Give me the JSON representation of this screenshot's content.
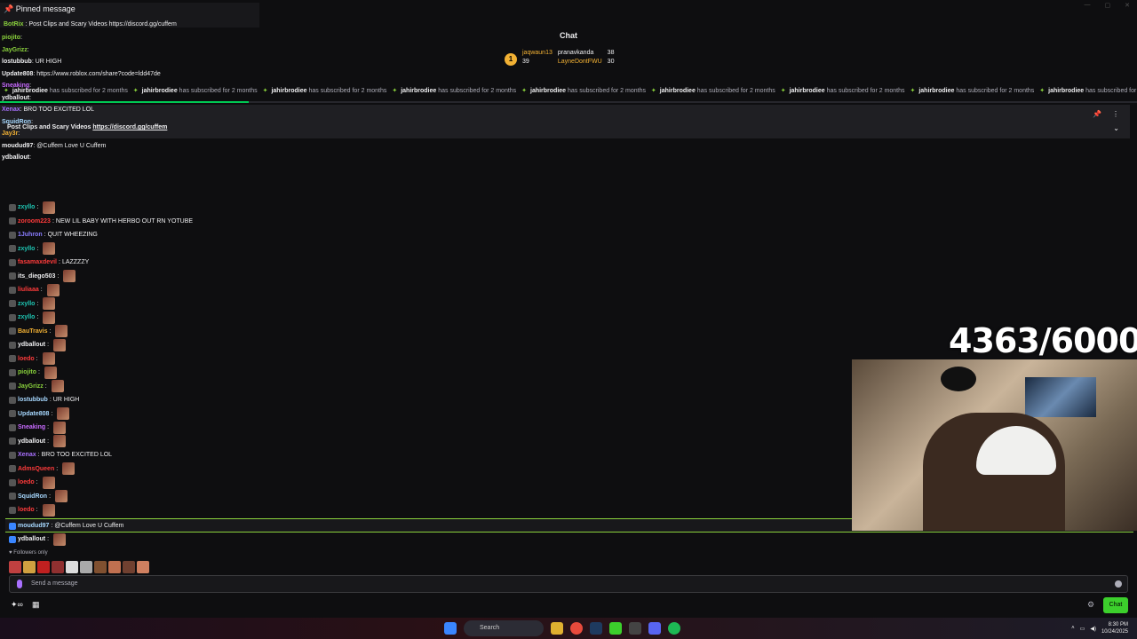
{
  "pinned_top": {
    "title": "Pinned message",
    "user": "BotRix",
    "text": "Post Clips and Scary Videos https://discord.gg/cuffem"
  },
  "header": {
    "title": "Chat"
  },
  "leaderboard": {
    "first": {
      "name": "jaqwaun13",
      "count": "39"
    },
    "second": {
      "name": "pranavkanda",
      "count": "38"
    },
    "third": {
      "name": "LayneDontFWU",
      "count": "30"
    }
  },
  "ticker": {
    "user": "jahirbrodiee",
    "text": "has subscribed for 2 months"
  },
  "progress": {
    "fraction": 0.47
  },
  "pinned_card": {
    "text": "Post Clips and Scary Videos ",
    "link": "https://discord.gg/cuffem"
  },
  "left_chat": [
    {
      "user": "piojito",
      "text": ""
    },
    {
      "user": "JayGrizz",
      "text": ""
    },
    {
      "user": "lostubbub",
      "text": "UR HIGH"
    },
    {
      "user": "Update808",
      "text": "https://www.roblox.com/share?code=ldd47de"
    },
    {
      "user": "Sneaking",
      "text": ""
    },
    {
      "user": "ydballout",
      "text": ""
    },
    {
      "user": "Xenax",
      "text": "BRO TOO EXCITED LOL"
    },
    {
      "user": "SquidRon",
      "text": ""
    },
    {
      "user": "Jay3r",
      "text": ""
    },
    {
      "user": "moudud97",
      "text": "@Cuffem Love U Cuffem"
    },
    {
      "user": "ydballout",
      "text": ""
    }
  ],
  "messages": [
    {
      "user": "zxyllo",
      "text": "",
      "color": "#1ec7b4"
    },
    {
      "user": "zoroom223",
      "text": "NEW LIL BABY WITH HERBO OUT RN YOTUBE",
      "color": "#ff3b3b"
    },
    {
      "user": "1Juhron",
      "text": "QUIT WHEEZING",
      "color": "#8a7dff"
    },
    {
      "user": "zxyllo",
      "text": "",
      "color": "#1ec7b4"
    },
    {
      "user": "fasamaxdevil",
      "text": "LAZZZZY",
      "color": "#ff3b3b"
    },
    {
      "user": "its_diego503",
      "text": "",
      "color": "#efeff1"
    },
    {
      "user": "liuliaaa",
      "text": "",
      "color": "#ff3b3b"
    },
    {
      "user": "zxyllo",
      "text": "",
      "color": "#1ec7b4"
    },
    {
      "user": "zxyllo",
      "text": "",
      "color": "#1ec7b4"
    },
    {
      "user": "BauTravis",
      "text": "",
      "color": "#f2b134"
    },
    {
      "user": "ydballout",
      "text": "",
      "color": "#efeff1"
    },
    {
      "user": "loedo",
      "text": "",
      "color": "#ff3b3b"
    },
    {
      "user": "piojito",
      "text": "",
      "color": "#8ad23c"
    },
    {
      "user": "JayGrizz",
      "text": "",
      "color": "#8ad23c"
    },
    {
      "user": "lostubbub",
      "text": "UR HIGH",
      "color": "#a7d8ff"
    },
    {
      "user": "Update808",
      "text": "",
      "color": "#a7d8ff"
    },
    {
      "user": "Sneaking",
      "text": "",
      "color": "#c86bff"
    },
    {
      "user": "ydballout",
      "text": "",
      "color": "#efeff1"
    },
    {
      "user": "Xenax",
      "text": "BRO TOO EXCITED LOL",
      "color": "#a970ff"
    },
    {
      "user": "AdmsQueen",
      "text": "",
      "color": "#ff3b3b"
    },
    {
      "user": "loedo",
      "text": "",
      "color": "#ff3b3b"
    },
    {
      "user": "SquidRon",
      "text": "",
      "color": "#a7d8ff"
    },
    {
      "user": "loedo",
      "text": "",
      "color": "#ff3b3b"
    }
  ],
  "highlighted": {
    "user": "moudud97",
    "text": "@Cuffem Love U Cuffem"
  },
  "last_message": {
    "user": "ydballout",
    "text": ""
  },
  "followers_only": "Followers only",
  "counter": "4363/6000",
  "input": {
    "placeholder": "Send a message"
  },
  "chat_button": "Chat",
  "taskbar": {
    "search": "Search",
    "time": "8:30 PM",
    "date": "10/24/2025"
  }
}
